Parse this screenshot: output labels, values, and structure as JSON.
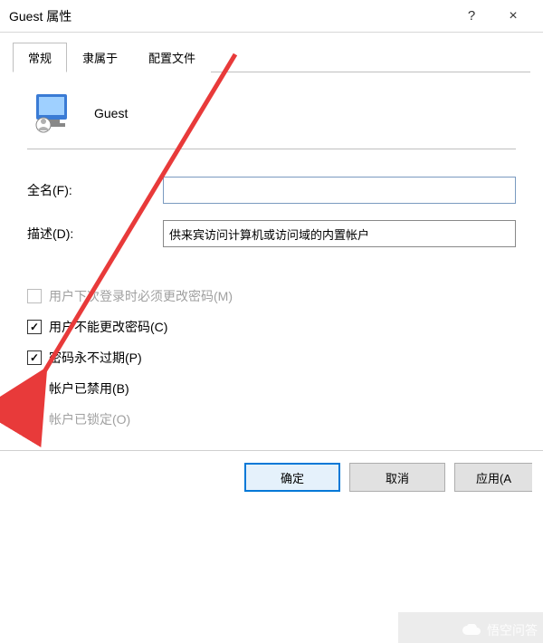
{
  "titlebar": {
    "title": "Guest 属性",
    "help": "?",
    "close": "×"
  },
  "tabs": [
    {
      "label": "常规",
      "active": true
    },
    {
      "label": "隶属于",
      "active": false
    },
    {
      "label": "配置文件",
      "active": false
    }
  ],
  "user": {
    "name": "Guest"
  },
  "fields": {
    "fullname_label": "全名(F):",
    "fullname_value": "",
    "description_label": "描述(D):",
    "description_value": "供来宾访问计算机或访问域的内置帐户"
  },
  "checks": [
    {
      "label": "用户下次登录时必须更改密码(M)",
      "checked": false,
      "enabled": false
    },
    {
      "label": "用户不能更改密码(C)",
      "checked": true,
      "enabled": true
    },
    {
      "label": "密码永不过期(P)",
      "checked": true,
      "enabled": true
    },
    {
      "label": "帐户已禁用(B)",
      "checked": true,
      "enabled": true
    },
    {
      "label": "帐户已锁定(O)",
      "checked": false,
      "enabled": false
    }
  ],
  "buttons": {
    "ok": "确定",
    "cancel": "取消",
    "apply": "应用(A"
  },
  "watermark": "悟空问答"
}
